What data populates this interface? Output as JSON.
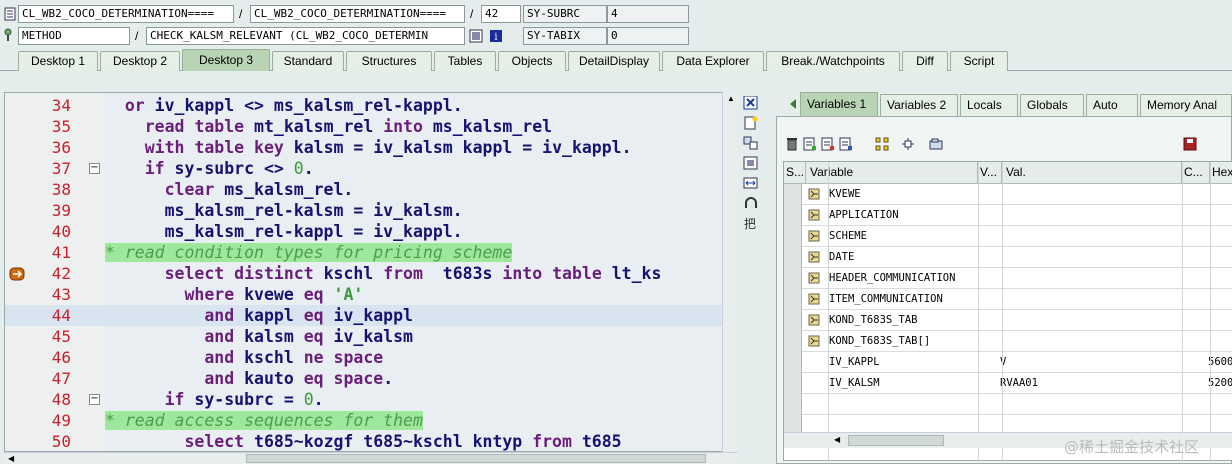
{
  "header": {
    "row1": {
      "field1": "CL_WB2_COCO_DETERMINATION====",
      "field2": "CL_WB2_COCO_DETERMINATION====",
      "sep1": "/",
      "sep2": "/",
      "line_no": "42",
      "sysvar": "SY-SUBRC",
      "sysval": "4"
    },
    "row2": {
      "field1": "METHOD",
      "field2": "CHECK_KALSM_RELEVANT (CL_WB2_COCO_DETERMIN",
      "sep1": "/",
      "sysvar": "SY-TABIX",
      "sysval": "0"
    }
  },
  "tabs": [
    "Desktop 1",
    "Desktop 2",
    "Desktop 3",
    "Standard",
    "Structures",
    "Tables",
    "Objects",
    "DetailDisplay",
    "Data Explorer",
    "Break./Watchpoints",
    "Diff",
    "Script"
  ],
  "active_tab": "Desktop 3",
  "code": {
    "lines": [
      {
        "n": "34",
        "t": "  or iv_kappl <> ms_kalsm_rel-kappl."
      },
      {
        "n": "35",
        "t": "    read table mt_kalsm_rel into ms_kalsm_rel"
      },
      {
        "n": "36",
        "t": "    with table key kalsm = iv_kalsm kappl = iv_kappl."
      },
      {
        "n": "37",
        "t": "    if sy-subrc <> 0."
      },
      {
        "n": "38",
        "t": "      clear ms_kalsm_rel."
      },
      {
        "n": "39",
        "t": "      ms_kalsm_rel-kalsm = iv_kalsm."
      },
      {
        "n": "40",
        "t": "      ms_kalsm_rel-kappl = iv_kappl."
      },
      {
        "n": "41",
        "t": "* read condition types for pricing scheme"
      },
      {
        "n": "42",
        "t": "      select distinct kschl from  t683s into table lt_ks"
      },
      {
        "n": "43",
        "t": "        where kvewe eq 'A'"
      },
      {
        "n": "44",
        "t": "          and kappl eq iv_kappl"
      },
      {
        "n": "45",
        "t": "          and kalsm eq iv_kalsm"
      },
      {
        "n": "46",
        "t": "          and kschl ne space"
      },
      {
        "n": "47",
        "t": "          and kauto eq space."
      },
      {
        "n": "48",
        "t": "      if sy-subrc = 0."
      },
      {
        "n": "49",
        "t": "* read access sequences for them"
      },
      {
        "n": "50",
        "t": "        select t685~kozgf t685~kschl kntyp from t685"
      }
    ]
  },
  "right_tabs": [
    "Variables 1",
    "Variables 2",
    "Locals",
    "Globals",
    "Auto",
    "Memory Anal"
  ],
  "active_right_tab": "Variables 1",
  "grid": {
    "headers": [
      "S...",
      "Variable",
      "V...",
      "Val.",
      "C...",
      "Hexa"
    ],
    "rows": [
      {
        "name": "KVEWE",
        "val": "",
        "hex": "",
        "icon": true
      },
      {
        "name": "APPLICATION",
        "val": "",
        "hex": "",
        "icon": true
      },
      {
        "name": "SCHEME",
        "val": "",
        "hex": "",
        "icon": true
      },
      {
        "name": "DATE",
        "val": "",
        "hex": "",
        "icon": true
      },
      {
        "name": "HEADER_COMMUNICATION",
        "val": "",
        "hex": "",
        "icon": true
      },
      {
        "name": "ITEM_COMMUNICATION",
        "val": "",
        "hex": "",
        "icon": true
      },
      {
        "name": "KOND_T683S_TAB",
        "val": "",
        "hex": "",
        "icon": true
      },
      {
        "name": "KOND_T683S_TAB[]",
        "val": "",
        "hex": "",
        "icon": true
      },
      {
        "name": "IV_KAPPL",
        "val": "V",
        "hex": "5600",
        "icon": false
      },
      {
        "name": "IV_KALSM",
        "val": "RVAA01",
        "hex": "5200",
        "icon": false
      },
      {
        "name": "",
        "val": "",
        "hex": "",
        "icon": false
      },
      {
        "name": "",
        "val": "",
        "hex": "",
        "icon": false
      }
    ]
  },
  "watermark": "@稀土掘金技术社区"
}
